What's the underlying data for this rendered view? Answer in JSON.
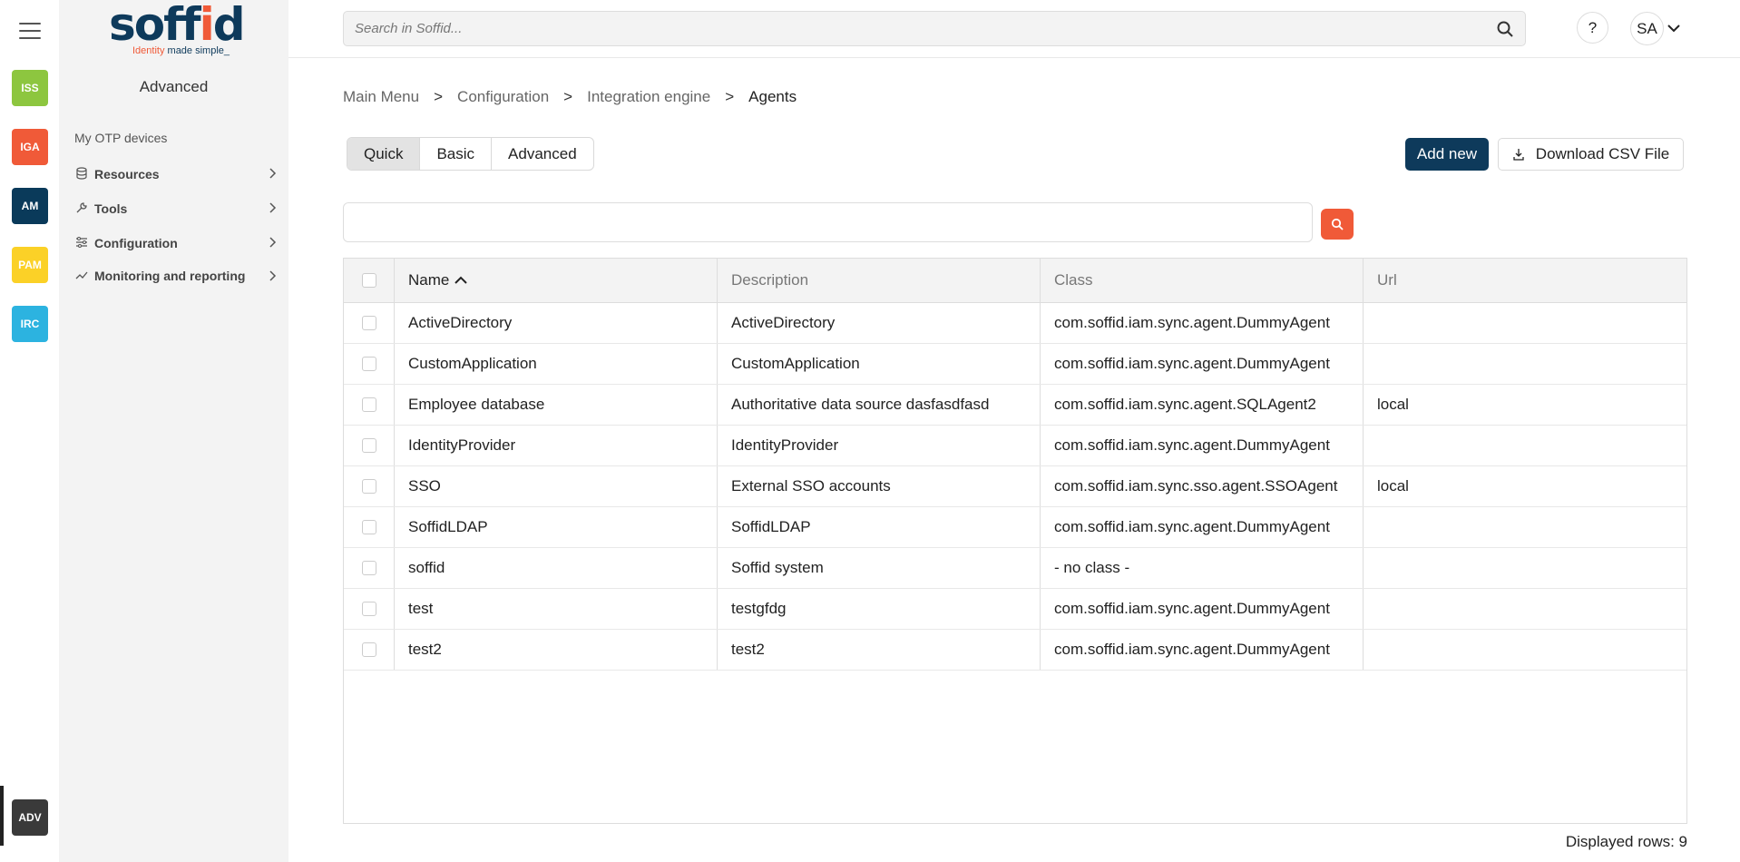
{
  "rail": {
    "modules": [
      {
        "label": "ISS",
        "color": "#8dc63f"
      },
      {
        "label": "IGA",
        "color": "#f05a38"
      },
      {
        "label": "AM",
        "color": "#0a3a5a"
      },
      {
        "label": "PAM",
        "color": "#fbd127"
      },
      {
        "label": "IRC",
        "color": "#2cb3e0"
      }
    ],
    "active_module": "ADV"
  },
  "logo": {
    "text_a": "soff",
    "text_i": "i",
    "text_b": "d",
    "tag_a": "Identity",
    "tag_b": " made simple_"
  },
  "menu": {
    "title": "Advanced",
    "otp": "My OTP devices",
    "items": [
      {
        "label": "Resources",
        "icon": "database-icon"
      },
      {
        "label": "Tools",
        "icon": "wrench-icon"
      },
      {
        "label": "Configuration",
        "icon": "sliders-icon"
      },
      {
        "label": "Monitoring and reporting",
        "icon": "chart-line-icon"
      }
    ]
  },
  "header": {
    "search_placeholder": "Search in Soffid...",
    "help": "?",
    "user_initials": "SA"
  },
  "breadcrumb": {
    "items": [
      "Main Menu",
      "Configuration",
      "Integration engine"
    ],
    "current": "Agents",
    "separator": ">"
  },
  "tabs": [
    "Quick",
    "Basic",
    "Advanced"
  ],
  "active_tab": "Quick",
  "actions": {
    "add_new": "Add new",
    "download_csv": "Download CSV File"
  },
  "filter": {
    "value": ""
  },
  "table": {
    "columns": [
      "Name",
      "Description",
      "Class",
      "Url"
    ],
    "sorted_by": "Name",
    "sort_dir": "asc",
    "rows": [
      [
        "ActiveDirectory",
        "ActiveDirectory",
        "com.soffid.iam.sync.agent.DummyAgent",
        ""
      ],
      [
        "CustomApplication",
        "CustomApplication",
        "com.soffid.iam.sync.agent.DummyAgent",
        ""
      ],
      [
        "Employee database",
        "Authoritative data source dasfasdfasd",
        "com.soffid.iam.sync.agent.SQLAgent2",
        "local"
      ],
      [
        "IdentityProvider",
        "IdentityProvider",
        "com.soffid.iam.sync.agent.DummyAgent",
        ""
      ],
      [
        "SSO",
        "External SSO accounts",
        "com.soffid.iam.sync.sso.agent.SSOAgent",
        "local"
      ],
      [
        "SoffidLDAP",
        "SoffidLDAP",
        "com.soffid.iam.sync.agent.DummyAgent",
        ""
      ],
      [
        "soffid",
        "Soffid system",
        "- no class -",
        ""
      ],
      [
        "test",
        "testgfdg",
        "com.soffid.iam.sync.agent.DummyAgent",
        ""
      ],
      [
        "test2",
        "test2",
        "com.soffid.iam.sync.agent.DummyAgent",
        ""
      ]
    ]
  },
  "footer": {
    "displayed_rows": "Displayed rows: 9"
  }
}
